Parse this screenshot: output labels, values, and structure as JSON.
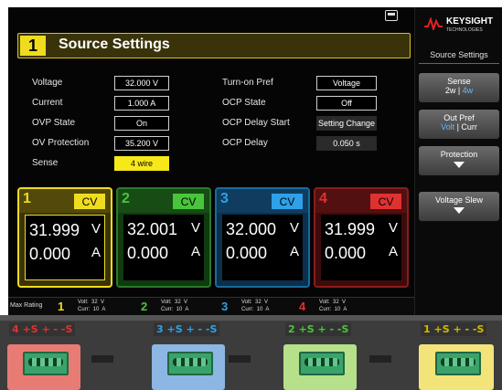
{
  "title": {
    "num": "1",
    "text": "Source Settings"
  },
  "settings_left": [
    {
      "label": "Voltage",
      "value": "32.000  V",
      "style": "normal"
    },
    {
      "label": "Current",
      "value": "1.000  A",
      "style": "normal"
    },
    {
      "label": "OVP State",
      "value": "On",
      "style": "normal"
    },
    {
      "label": "OV Protection",
      "value": "35.200  V",
      "style": "normal"
    },
    {
      "label": "Sense",
      "value": "4 wire",
      "style": "hl"
    }
  ],
  "settings_right": [
    {
      "label": "Turn-on Pref",
      "value": "Voltage",
      "style": "normal"
    },
    {
      "label": "OCP State",
      "value": "Off",
      "style": "normal"
    },
    {
      "label": "OCP Delay Start",
      "value": "Setting Change",
      "style": "dim"
    },
    {
      "label": "OCP Delay",
      "value": "0.050  s",
      "style": "dim"
    }
  ],
  "channels": [
    {
      "num": "1",
      "mode": "CV",
      "voltage": "31.999",
      "v_unit": "V",
      "current": "0.000",
      "a_unit": "A",
      "color": "#f0dc1e",
      "bg": "#3a3309",
      "border": "#f0dc1e"
    },
    {
      "num": "2",
      "mode": "CV",
      "voltage": "32.001",
      "v_unit": "V",
      "current": "0.000",
      "a_unit": "A",
      "color": "#49c43b",
      "bg": "#103a10",
      "border": "#2a7a2a"
    },
    {
      "num": "3",
      "mode": "CV",
      "voltage": "32.000",
      "v_unit": "V",
      "current": "0.000",
      "a_unit": "A",
      "color": "#2ea1e8",
      "bg": "#0c2f4a",
      "border": "#1a6aa0"
    },
    {
      "num": "4",
      "mode": "CV",
      "voltage": "31.999",
      "v_unit": "V",
      "current": "0.000",
      "a_unit": "A",
      "color": "#e03131",
      "bg": "#3d0b0b",
      "border": "#8a1c1c"
    }
  ],
  "max_rating": {
    "label": "Max Rating",
    "entries": [
      {
        "num": "1",
        "color": "#f0dc1e",
        "text": "Volt:  32  V\nCurr:  10  A"
      },
      {
        "num": "2",
        "color": "#49c43b",
        "text": "Volt:  32  V\nCurr:  10  A"
      },
      {
        "num": "3",
        "color": "#2ea1e8",
        "text": "Volt:  32  V\nCurr:  10  A"
      },
      {
        "num": "4",
        "color": "#e03131",
        "text": "Volt:  32  V\nCurr:  10  A"
      }
    ]
  },
  "sidebar": {
    "brand": "KEYSIGHT",
    "brand_sub": "TECHNOLOGIES",
    "title": "Source Settings",
    "buttons": [
      {
        "line1": "Sense",
        "line2a": "2w",
        "line2b": "4w"
      },
      {
        "line1": "Out Pref",
        "line2a": "Volt",
        "line2b": "Curr"
      },
      {
        "line1": "Protection"
      },
      {
        "line1": "Voltage Slew"
      }
    ]
  },
  "connectors": [
    {
      "label": "4 +S  +  -  -S",
      "color": "#e03131",
      "bg": "#e87b73"
    },
    {
      "label": "3 +S  +  -  -S",
      "color": "#2ea1e8",
      "bg": "#8cb6e3"
    },
    {
      "label": "2 +S  +  -  -S",
      "color": "#49c43b",
      "bg": "#b7e08a"
    },
    {
      "label": "1 +S  +  -  -S",
      "color": "#d4b800",
      "bg": "#f3e47a"
    }
  ]
}
